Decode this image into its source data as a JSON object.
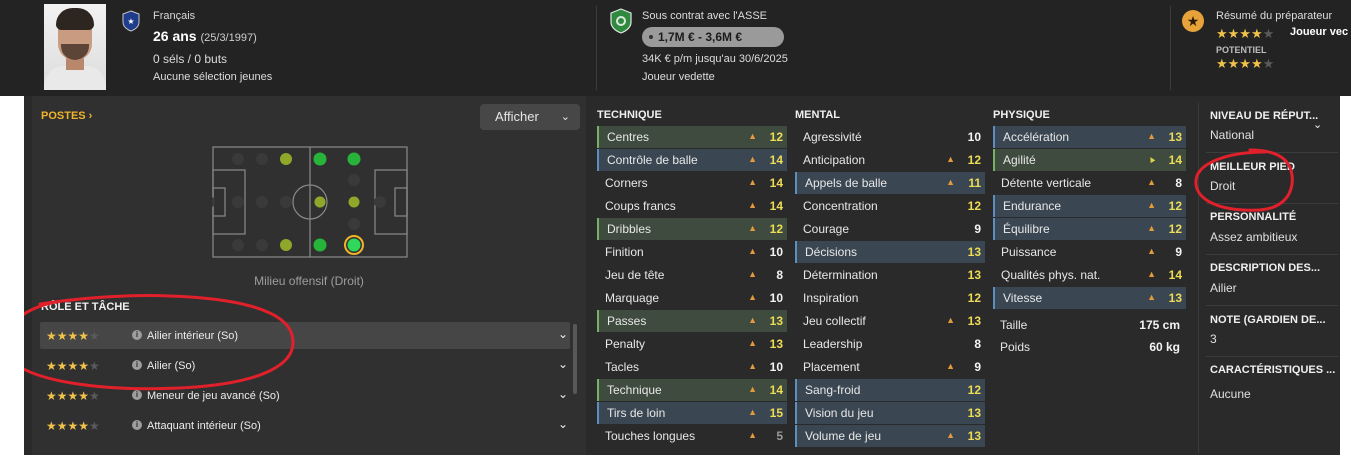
{
  "header": {
    "nationality": "Français",
    "age": "26 ans",
    "birthdate": "(25/3/1997)",
    "caps": "0 séls / 0 buts",
    "youth_caps": "Aucune sélection jeunes",
    "contract": "Sous contrat avec l'ASSE",
    "value": "1,7M € - 3,6M €",
    "wage": "34K € p/m jusqu'au 30/6/2025",
    "squad_status": "Joueur vedette",
    "coach_report_title": "Résumé du préparateur",
    "current_ability_stars": 4,
    "current_ability_label": "Joueur vec",
    "potential_label": "POTENTIEL",
    "potential_stars": 4
  },
  "positions": {
    "title": "POSTES",
    "display_button": "Afficher",
    "selected_position": "Milieu offensif (Droit)"
  },
  "roles": {
    "title": "RÔLE ET TÂCHE",
    "items": [
      {
        "name": "Ailier intérieur (So)",
        "stars": 4
      },
      {
        "name": "Ailier (So)",
        "stars": 4
      },
      {
        "name": "Meneur de jeu avancé (So)",
        "stars": 4
      },
      {
        "name": "Attaquant intérieur (So)",
        "stars": 4
      }
    ]
  },
  "technique": {
    "title": "TECHNIQUE",
    "items": [
      {
        "name": "Centres",
        "value": "12",
        "hl": "green",
        "color": "yellow"
      },
      {
        "name": "Contrôle de balle",
        "value": "14",
        "hl": "blue",
        "color": "yellow"
      },
      {
        "name": "Corners",
        "value": "14",
        "hl": "",
        "color": "yellow"
      },
      {
        "name": "Coups francs",
        "value": "14",
        "hl": "",
        "color": "yellow"
      },
      {
        "name": "Dribbles",
        "value": "12",
        "hl": "green",
        "color": "yellow"
      },
      {
        "name": "Finition",
        "value": "10",
        "hl": "",
        "color": "white"
      },
      {
        "name": "Jeu de tête",
        "value": "8",
        "hl": "",
        "color": "white"
      },
      {
        "name": "Marquage",
        "value": "10",
        "hl": "",
        "color": "white"
      },
      {
        "name": "Passes",
        "value": "13",
        "hl": "green",
        "color": "yellow"
      },
      {
        "name": "Penalty",
        "value": "13",
        "hl": "",
        "color": "yellow"
      },
      {
        "name": "Tacles",
        "value": "10",
        "hl": "",
        "color": "white"
      },
      {
        "name": "Technique",
        "value": "14",
        "hl": "green",
        "color": "yellow"
      },
      {
        "name": "Tirs de loin",
        "value": "15",
        "hl": "blue",
        "color": "yellow"
      },
      {
        "name": "Touches longues",
        "value": "5",
        "hl": "",
        "color": "gray"
      }
    ]
  },
  "mental": {
    "title": "MENTAL",
    "items": [
      {
        "name": "Agressivité",
        "value": "10",
        "hl": "",
        "color": "white",
        "arrow": false
      },
      {
        "name": "Anticipation",
        "value": "12",
        "hl": "",
        "color": "yellow",
        "arrow": true
      },
      {
        "name": "Appels de balle",
        "value": "11",
        "hl": "blue",
        "color": "yellow",
        "arrow": true
      },
      {
        "name": "Concentration",
        "value": "12",
        "hl": "",
        "color": "yellow",
        "arrow": false
      },
      {
        "name": "Courage",
        "value": "9",
        "hl": "",
        "color": "white",
        "arrow": false
      },
      {
        "name": "Décisions",
        "value": "13",
        "hl": "blue",
        "color": "yellow",
        "arrow": false
      },
      {
        "name": "Détermination",
        "value": "13",
        "hl": "",
        "color": "yellow",
        "arrow": false
      },
      {
        "name": "Inspiration",
        "value": "12",
        "hl": "",
        "color": "yellow",
        "arrow": false
      },
      {
        "name": "Jeu collectif",
        "value": "13",
        "hl": "",
        "color": "yellow",
        "arrow": true
      },
      {
        "name": "Leadership",
        "value": "8",
        "hl": "",
        "color": "white",
        "arrow": false
      },
      {
        "name": "Placement",
        "value": "9",
        "hl": "",
        "color": "white",
        "arrow": true
      },
      {
        "name": "Sang-froid",
        "value": "12",
        "hl": "blue",
        "color": "yellow",
        "arrow": false
      },
      {
        "name": "Vision du jeu",
        "value": "13",
        "hl": "blue",
        "color": "yellow",
        "arrow": false
      },
      {
        "name": "Volume de jeu",
        "value": "13",
        "hl": "blue",
        "color": "yellow",
        "arrow": true
      }
    ]
  },
  "physique": {
    "title": "PHYSIQUE",
    "items": [
      {
        "name": "Accélération",
        "value": "13",
        "hl": "blue",
        "color": "yellow"
      },
      {
        "name": "Agilité",
        "value": "14",
        "hl": "green",
        "color": "yellow"
      },
      {
        "name": "Détente verticale",
        "value": "8",
        "hl": "",
        "color": "white"
      },
      {
        "name": "Endurance",
        "value": "12",
        "hl": "blue",
        "color": "yellow"
      },
      {
        "name": "Équilibre",
        "value": "12",
        "hl": "blue",
        "color": "yellow"
      },
      {
        "name": "Puissance",
        "value": "9",
        "hl": "",
        "color": "white"
      },
      {
        "name": "Qualités phys. nat.",
        "value": "14",
        "hl": "",
        "color": "yellow"
      },
      {
        "name": "Vitesse",
        "value": "13",
        "hl": "blue",
        "color": "yellow"
      }
    ],
    "height_label": "Taille",
    "height": "175 cm",
    "weight_label": "Poids",
    "weight": "60 kg"
  },
  "info": {
    "reputation_title": "NIVEAU DE RÉPUT...",
    "reputation": "National",
    "foot_title": "MEILLEUR PIED",
    "foot": "Droit",
    "personality_title": "PERSONNALITÉ",
    "personality": "Assez ambitieux",
    "description_title": "DESCRIPTION DES...",
    "description": "Ailier",
    "gk_note_title": "NOTE (GARDIEN DE...",
    "gk_note": "3",
    "traits_title": "CARACTÉRISTIQUES ...",
    "traits": "Aucune"
  },
  "colors": {
    "accent": "#f0b429",
    "annotation": "#e0202a",
    "highlight_green": "#75b265",
    "highlight_blue": "#5c8fc0",
    "value_yellow": "#eddc55"
  }
}
